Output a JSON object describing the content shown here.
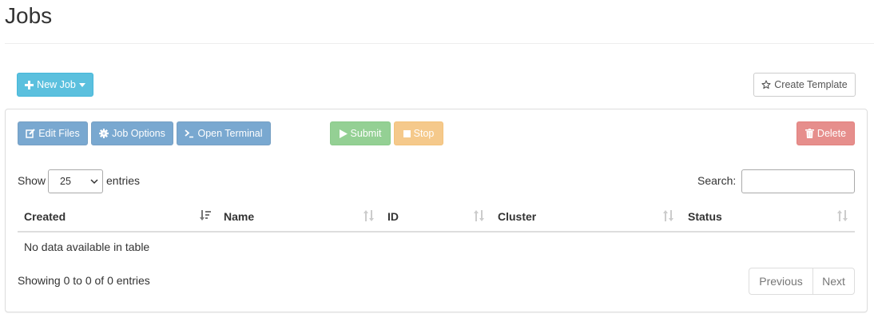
{
  "page": {
    "title": "Jobs"
  },
  "toolbar_top": {
    "new_job_label": "New Job",
    "create_template_label": "Create Template"
  },
  "actions": {
    "edit_files": "Edit Files",
    "job_options": "Job Options",
    "open_terminal": "Open Terminal",
    "submit": "Submit",
    "stop": "Stop",
    "delete": "Delete"
  },
  "table_controls": {
    "show_label": "Show",
    "page_length": "25",
    "entries_label": "entries",
    "search_label": "Search:",
    "search_value": ""
  },
  "table": {
    "columns": [
      "Created",
      "Name",
      "ID",
      "Cluster",
      "Status"
    ],
    "empty_message": "No data available in table"
  },
  "footer": {
    "info": "Showing 0 to 0 of 0 entries",
    "previous_label": "Previous",
    "next_label": "Next"
  },
  "colors": {
    "info": "#5bc0de",
    "primary": "#337ab7",
    "success": "#5cb85c",
    "warning": "#f0ad4e",
    "danger": "#d9534f"
  },
  "icons": {
    "new_job": "plus-icon",
    "new_job_caret": "caret-down-icon",
    "create_template": "star-outline-icon",
    "edit_files": "edit-icon",
    "job_options": "gear-icon",
    "open_terminal": "terminal-icon",
    "submit": "play-icon",
    "stop": "stop-icon",
    "delete": "trash-icon"
  }
}
